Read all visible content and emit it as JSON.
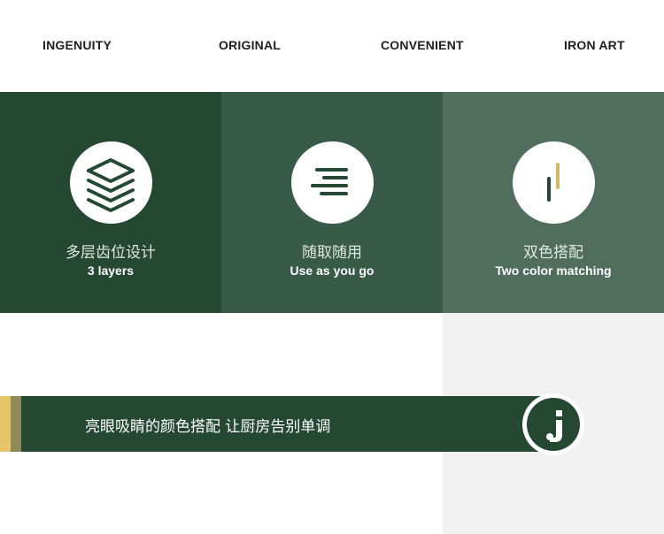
{
  "nav": {
    "items": [
      {
        "label": "INGENUITY"
      },
      {
        "label": "ORIGINAL"
      },
      {
        "label": "CONVENIENT"
      },
      {
        "label": "IRON ART"
      }
    ]
  },
  "features": [
    {
      "title_cn": "多层齿位设计",
      "title_en": "3 layers",
      "icon": "layers-icon",
      "bg": "#244832"
    },
    {
      "title_cn": "随取随用",
      "title_en": "Use as you go",
      "icon": "menu-lines-icon",
      "bg": "#385a48"
    },
    {
      "title_cn": "双色搭配",
      "title_en": "Two color matching",
      "icon": "two-color-bars-icon",
      "bg": "#506d5e"
    }
  ],
  "banner": {
    "text": "亮眼吸睛的颜色搭配 让厨房告别单调",
    "logo_icon": "j-logo-icon"
  },
  "colors": {
    "dark_green": "#244832",
    "mid_green": "#385a48",
    "light_green": "#506d5e",
    "accent_yellow": "#e6c46a",
    "accent_olive": "#8f8a56",
    "gray_block": "#f1f1f1"
  }
}
